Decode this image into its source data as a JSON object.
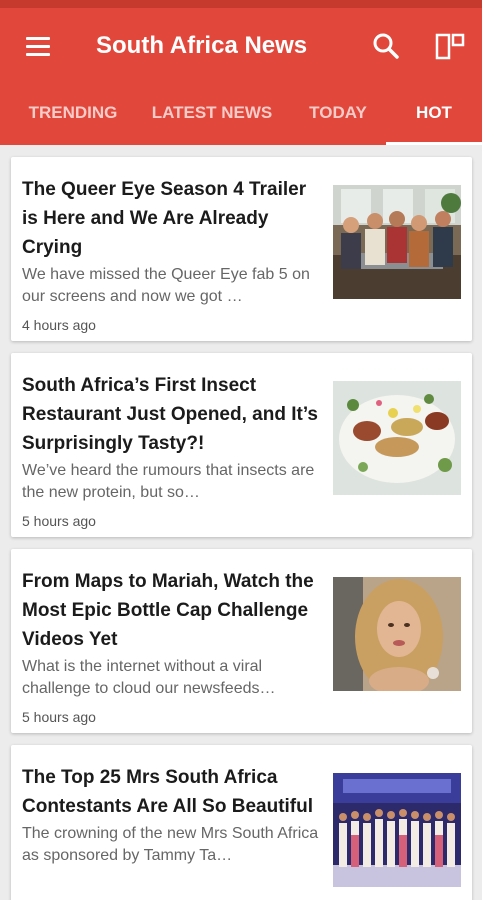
{
  "app": {
    "title": "South Africa News",
    "colors": {
      "primary": "#e2473b",
      "status_bar": "#c63a2e",
      "background": "#ececec"
    }
  },
  "toolbar": {
    "menu_icon": "hamburger-menu-icon",
    "search_icon": "search-icon",
    "layout_icon": "layout-toggle-icon"
  },
  "tabs": [
    {
      "label": "TRENDING",
      "active": false
    },
    {
      "label": "LATEST NEWS",
      "active": false
    },
    {
      "label": "TODAY",
      "active": false
    },
    {
      "label": "HOT",
      "active": true
    }
  ],
  "articles": [
    {
      "title": "The Queer Eye Season 4 Trailer is Here and We Are Already Crying",
      "snippet": "We have missed the Queer Eye fab 5 on our screens and now we got …",
      "time": "4 hours ago",
      "thumbnail": "queer-eye-cast-photo"
    },
    {
      "title": "South Africa’s First Insect Restaurant Just Opened, and It’s Surprisingly Tasty?!",
      "snippet": "We’ve heard the rumours that insects are the new protein, but so…",
      "time": "5 hours ago",
      "thumbnail": "insect-dish-photo"
    },
    {
      "title": "From Maps to Mariah, Watch the Most Epic Bottle Cap Challenge Videos Yet",
      "snippet": "What is the internet without a viral challenge to cloud our newsfeeds…",
      "time": "5 hours ago",
      "thumbnail": "mariah-carey-photo"
    },
    {
      "title": "The Top 25 Mrs South Africa Contestants Are All So Beautiful",
      "snippet": "The crowning of the new Mrs South Africa as sponsored by Tammy Ta…",
      "time": "",
      "thumbnail": "mrs-south-africa-contestants-photo"
    }
  ]
}
